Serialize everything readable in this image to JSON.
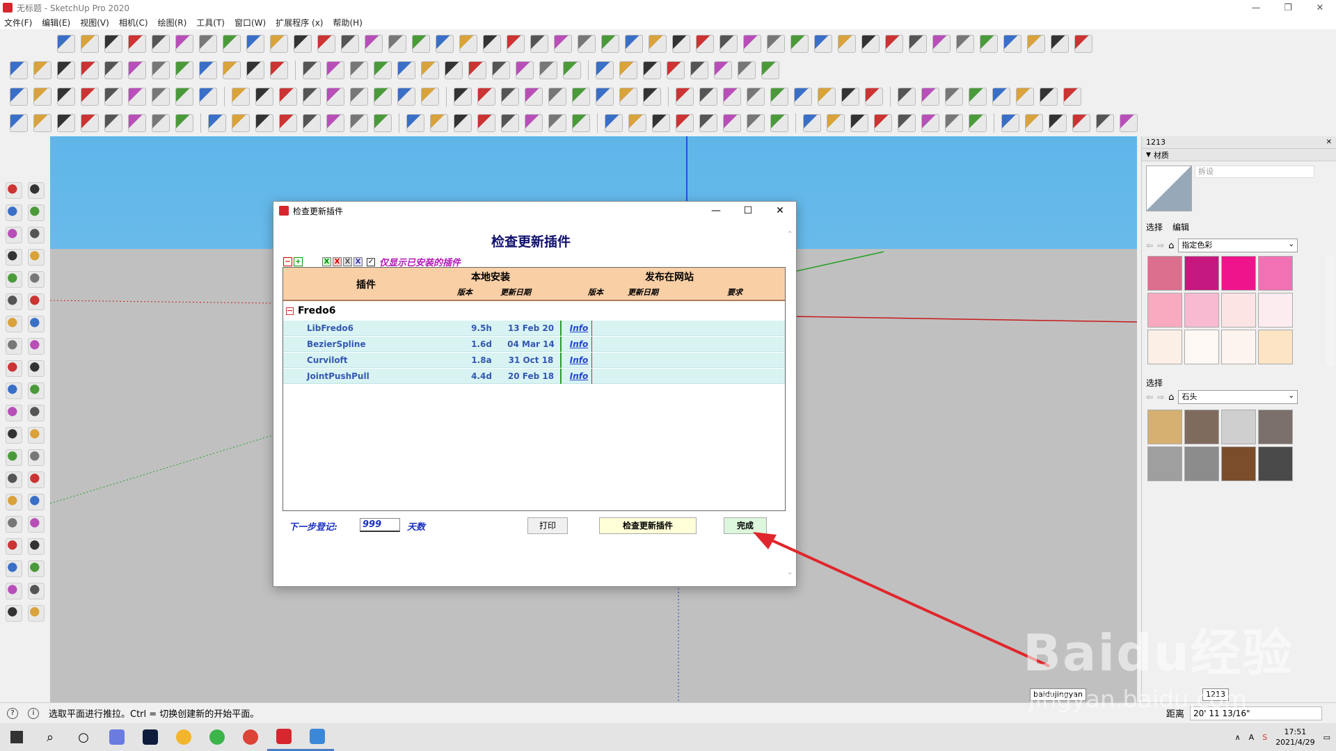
{
  "window": {
    "title": "无标题 - SketchUp Pro 2020"
  },
  "menu": [
    "文件(F)",
    "编辑(E)",
    "视图(V)",
    "相机(C)",
    "绘图(R)",
    "工具(T)",
    "窗口(W)",
    "扩展程序 (x)",
    "帮助(H)"
  ],
  "dialog": {
    "window_title": "检查更新插件",
    "heading": "检查更新插件",
    "filter_label": "仅显示已安装的插件",
    "columns": {
      "plugin": "插件",
      "local": "本地安装",
      "web": "发布在网站",
      "local_version": "版本",
      "local_date": "更新日期",
      "web_version": "版本",
      "web_date": "更新日期",
      "requirement": "要求"
    },
    "group": "Fredo6",
    "rows": [
      {
        "name": "LibFredo6",
        "version": "9.5h",
        "date": "13 Feb 20",
        "info": "Info"
      },
      {
        "name": "BezierSpline",
        "version": "1.6d",
        "date": "04 Mar 14",
        "info": "Info"
      },
      {
        "name": "Curviloft",
        "version": "1.8a",
        "date": "31 Oct 18",
        "info": "Info"
      },
      {
        "name": "JointPushPull",
        "version": "4.4d",
        "date": "20 Feb 18",
        "info": "Info"
      }
    ],
    "next_label": "下一步登记:",
    "days_value": "999",
    "days_label": "天数",
    "print_button": "打印",
    "check_button": "检查更新插件",
    "done_button": "完成"
  },
  "right_panel": {
    "tray_title": "1213",
    "section": "材质",
    "material_name_placeholder": "拆设",
    "tab_select": "选择",
    "tab_edit": "编辑",
    "library1": "指定色彩",
    "colors1": [
      "#dc6e8e",
      "#c4187e",
      "#f0148c",
      "#f271b4",
      "#f9aac0",
      "#f8bad0",
      "#fce4e4",
      "#fcecf0",
      "#fcefe6",
      "#fdf8f4",
      "#fdf4ef",
      "#fce4c4"
    ],
    "section2": "选择",
    "library2": "石头",
    "colors2": [
      "#d5b071",
      "#7f6a5e",
      "#cfcfcf",
      "#7b6f6b",
      "#9f9f9f",
      "#8c8c8c",
      "#7c4d2a",
      "#4a4a4a"
    ]
  },
  "status": {
    "message": "选取平面进行推拉。Ctrl = 切换创建新的开始平面。",
    "measure_label": "距离",
    "measure_value": "20' 11 13/16\""
  },
  "taskbar": {
    "time": "17:51",
    "date": "2021/4/29",
    "tooltip1": "baidujingyan",
    "tooltip2": "1213"
  },
  "watermark": {
    "main": "Baidu经验",
    "sub": "jingyan.baidu.com"
  }
}
